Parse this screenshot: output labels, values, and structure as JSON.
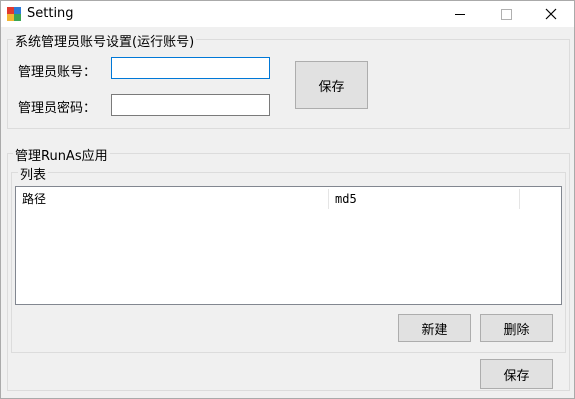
{
  "window": {
    "title": "Setting"
  },
  "admin_group": {
    "title": "系统管理员账号设置(运行账号)",
    "account_label": "管理员账号：",
    "account_value": "",
    "password_label": "管理员密码：",
    "password_value": "",
    "save_label": "保存"
  },
  "runas_group": {
    "title": "管理RunAs应用",
    "list_group_title": "列表",
    "columns": [
      "路径",
      "md5"
    ],
    "new_label": "新建",
    "delete_label": "删除"
  },
  "footer": {
    "save_label": "保存"
  },
  "colors": {
    "focus_border": "#0078d7",
    "button_bg": "#e1e1e1",
    "window_bg": "#f0f0f0"
  }
}
